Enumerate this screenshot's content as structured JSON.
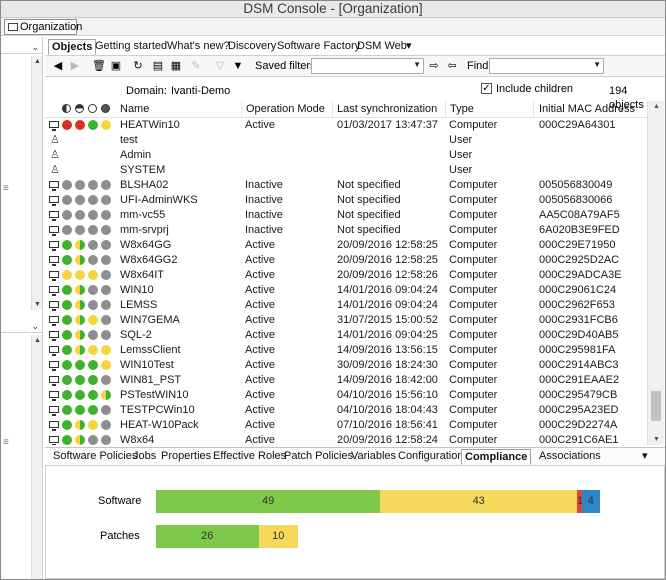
{
  "window": {
    "title": "DSM Console - [Organization]"
  },
  "org_button": {
    "label": "Organization"
  },
  "left_panel": {
    "drop_symbol": "⌄"
  },
  "tabs": [
    {
      "label": "Objects",
      "selected": true
    },
    {
      "label": "Getting started"
    },
    {
      "label": "What's new?"
    },
    {
      "label": "Discovery"
    },
    {
      "label": "Software Factory"
    },
    {
      "label": "DSM Web"
    },
    {
      "label": "▾"
    }
  ],
  "toolbar": {
    "saved_filters_label": "Saved filters:",
    "saved_filters_value": "",
    "find_label": "Find:",
    "find_value": ""
  },
  "info": {
    "domain_label": "Domain:",
    "domain_value": "Ivanti-Demo",
    "include_children_label": "Include children",
    "include_children_checked": true,
    "count": "194 objects"
  },
  "columns": [
    "Name",
    "Operation Mode",
    "Last synchronization",
    "Type",
    "Initial MAC Address"
  ],
  "rows": [
    {
      "icon": "computer",
      "dots": [
        "red",
        "red",
        "green",
        "yellow"
      ],
      "name": "HEATWin10",
      "mode": "Active",
      "sync": "01/03/2017 13:47:37",
      "type": "Computer",
      "mac": "000C29A64301"
    },
    {
      "icon": "user",
      "dots": [],
      "name": "test",
      "mode": "",
      "sync": "",
      "type": "User",
      "mac": ""
    },
    {
      "icon": "user",
      "dots": [],
      "name": "Admin",
      "mode": "",
      "sync": "",
      "type": "User",
      "mac": ""
    },
    {
      "icon": "user",
      "dots": [],
      "name": "SYSTEM",
      "mode": "",
      "sync": "",
      "type": "User",
      "mac": ""
    },
    {
      "icon": "computer",
      "dots": [
        "grey",
        "grey",
        "grey",
        "grey"
      ],
      "name": "BLSHA02",
      "mode": "Inactive",
      "sync": "Not specified",
      "type": "Computer",
      "mac": "005056830049"
    },
    {
      "icon": "computer",
      "dots": [
        "grey",
        "grey",
        "grey",
        "grey"
      ],
      "name": "UFI-AdminWKS",
      "mode": "Inactive",
      "sync": "Not specified",
      "type": "Computer",
      "mac": "005056830066"
    },
    {
      "icon": "computer",
      "dots": [
        "grey",
        "grey",
        "grey",
        "grey"
      ],
      "name": "mm-vc55",
      "mode": "Inactive",
      "sync": "Not specified",
      "type": "Computer",
      "mac": "AA5C08A79AF5"
    },
    {
      "icon": "computer",
      "dots": [
        "grey",
        "grey",
        "grey",
        "grey"
      ],
      "name": "mm-srvprj",
      "mode": "Inactive",
      "sync": "Not specified",
      "type": "Computer",
      "mac": "6A020B3E9FED"
    },
    {
      "icon": "computer",
      "dots": [
        "green",
        "half",
        "grey",
        "grey"
      ],
      "name": "W8x64GG",
      "mode": "Active",
      "sync": "20/09/2016 12:58:25",
      "type": "Computer",
      "mac": "000C29E71950"
    },
    {
      "icon": "computer",
      "dots": [
        "green",
        "half",
        "grey",
        "grey"
      ],
      "name": "W8x64GG2",
      "mode": "Active",
      "sync": "20/09/2016 12:58:25",
      "type": "Computer",
      "mac": "000C2925D2AC"
    },
    {
      "icon": "computer",
      "dots": [
        "yellow",
        "yellow",
        "yellow",
        "grey"
      ],
      "name": "W8x64IT",
      "mode": "Active",
      "sync": "20/09/2016 12:58:26",
      "type": "Computer",
      "mac": "000C29ADCA3E"
    },
    {
      "icon": "computer",
      "dots": [
        "green",
        "half",
        "grey",
        "grey"
      ],
      "name": "WIN10",
      "mode": "Active",
      "sync": "14/01/2016 09:04:24",
      "type": "Computer",
      "mac": "000C29061C24"
    },
    {
      "icon": "computer",
      "dots": [
        "green",
        "half",
        "grey",
        "grey"
      ],
      "name": "LEMSS",
      "mode": "Active",
      "sync": "14/01/2016 09:04:24",
      "type": "Computer",
      "mac": "000C2962F653"
    },
    {
      "icon": "computer",
      "dots": [
        "green",
        "half",
        "yellow",
        "grey"
      ],
      "name": "WIN7GEMA",
      "mode": "Active",
      "sync": "31/07/2015 15:00:52",
      "type": "Computer",
      "mac": "000C2931FCB6"
    },
    {
      "icon": "computer",
      "dots": [
        "green",
        "half",
        "grey",
        "grey"
      ],
      "name": "SQL-2",
      "mode": "Active",
      "sync": "14/01/2016 09:04:25",
      "type": "Computer",
      "mac": "000C29D40AB5"
    },
    {
      "icon": "computer",
      "dots": [
        "green",
        "half",
        "yellow",
        "yellow"
      ],
      "name": "LemssClient",
      "mode": "Active",
      "sync": "14/09/2016 13:56:15",
      "type": "Computer",
      "mac": "000C295981FA"
    },
    {
      "icon": "computer",
      "dots": [
        "green",
        "green",
        "green",
        "yellow"
      ],
      "name": "WIN10Test",
      "mode": "Active",
      "sync": "30/09/2016 18:24:30",
      "type": "Computer",
      "mac": "000C2914ABC3"
    },
    {
      "icon": "computer",
      "dots": [
        "green",
        "green",
        "green",
        "grey"
      ],
      "name": "WIN81_PST",
      "mode": "Active",
      "sync": "14/09/2016 18:42:00",
      "type": "Computer",
      "mac": "000C291EAAE2"
    },
    {
      "icon": "computer",
      "dots": [
        "green",
        "green",
        "green",
        "half"
      ],
      "name": "PSTestWIN10",
      "mode": "Active",
      "sync": "04/10/2016 15:56:10",
      "type": "Computer",
      "mac": "000C295479CB"
    },
    {
      "icon": "computer",
      "dots": [
        "green",
        "green",
        "green",
        "grey"
      ],
      "name": "TESTPCWin10",
      "mode": "Active",
      "sync": "04/10/2016 18:04:43",
      "type": "Computer",
      "mac": "000C295A23ED"
    },
    {
      "icon": "computer",
      "dots": [
        "green",
        "half",
        "yellow",
        "grey"
      ],
      "name": "HEAT-W10Pack",
      "mode": "Active",
      "sync": "07/10/2016 18:56:41",
      "type": "Computer",
      "mac": "000C29D2274A"
    },
    {
      "icon": "computer",
      "dots": [
        "green",
        "half",
        "grey",
        "grey"
      ],
      "name": "W8x64",
      "mode": "Active",
      "sync": "20/09/2016 12:58:24",
      "type": "Computer",
      "mac": "000C291C6AE1"
    }
  ],
  "bottom_tabs": [
    {
      "label": "Software Policies"
    },
    {
      "label": "Jobs"
    },
    {
      "label": "Properties"
    },
    {
      "label": "Effective Roles"
    },
    {
      "label": "Patch Policies"
    },
    {
      "label": "Variables"
    },
    {
      "label": "Configuration"
    },
    {
      "label": "Compliance",
      "selected": true
    },
    {
      "label": "Associations"
    },
    {
      "label": "▾"
    }
  ],
  "chart_data": {
    "type": "bar",
    "orientation": "horizontal-stacked",
    "categories": [
      "Software",
      "Patches"
    ],
    "series": [
      {
        "color": "#7dc94a",
        "values": [
          49,
          26
        ]
      },
      {
        "color": "#f4d95a",
        "values": [
          43,
          10
        ]
      },
      {
        "color": "#d9483b",
        "values": [
          1,
          0
        ]
      },
      {
        "color": "#2e86c9",
        "values": [
          4,
          0
        ]
      }
    ],
    "data_labels": [
      [
        "49",
        "43",
        "1",
        "4"
      ],
      [
        "26",
        "10",
        "",
        ""
      ]
    ]
  }
}
